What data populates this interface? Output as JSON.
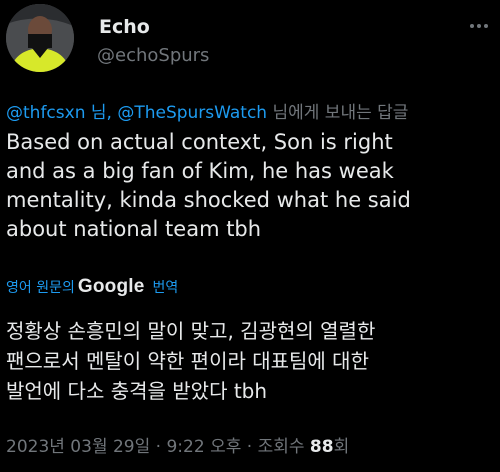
{
  "author": {
    "name": "Echo",
    "handle": "@echoSpurs"
  },
  "reply": {
    "mention1": "@thfcsxn",
    "separator": " 님, ",
    "mention2": "@TheSpursWatch",
    "suffix": " 님에게 보내는 답글"
  },
  "tweet": {
    "lines": [
      "Based on actual context, Son is right",
      "and as a big fan of Kim, he has weak",
      "mentality, kinda shocked what he said",
      "about national team tbh"
    ]
  },
  "translation": {
    "prefix": "영어 원문의",
    "provider": "Google",
    "suffix": "번역",
    "lines": [
      "정황상 손흥민의 말이 맞고, 김광현의 열렬한",
      "팬으로서 멘탈이 약한 편이라 대표팀에 대한",
      "발언에 다소 충격을 받았다 tbh"
    ]
  },
  "meta": {
    "date": "2023년 03월 29일",
    "sep1": " · ",
    "time": "9:22 오후",
    "sep2": " · ",
    "views_label": "조회수 ",
    "views_count": "88",
    "views_unit": "회"
  },
  "icons": {
    "more": "more-options-icon",
    "avatar": "profile-avatar"
  },
  "colors": {
    "background": "#000000",
    "text": "#e7e9ea",
    "secondary": "#71767b",
    "link": "#1d9bf0"
  }
}
